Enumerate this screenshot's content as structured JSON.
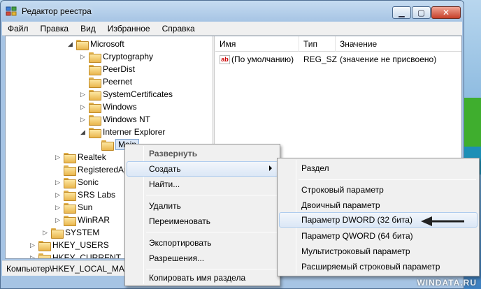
{
  "window": {
    "title": "Редактор реестра"
  },
  "menubar": [
    "Файл",
    "Правка",
    "Вид",
    "Избранное",
    "Справка"
  ],
  "tree": [
    {
      "label": "Microsoft",
      "expander": "◢"
    },
    {
      "label": "Cryptography",
      "expander": "▷"
    },
    {
      "label": "PeerDist",
      "expander": ""
    },
    {
      "label": "Peernet",
      "expander": ""
    },
    {
      "label": "SystemCertificates",
      "expander": "▷"
    },
    {
      "label": "Windows",
      "expander": "▷"
    },
    {
      "label": "Windows NT",
      "expander": "▷"
    },
    {
      "label": "Interner Explorer",
      "expander": "◢"
    },
    {
      "label": "Main",
      "expander": ""
    },
    {
      "label": "Realtek",
      "expander": "▷"
    },
    {
      "label": "RegisteredAp",
      "expander": ""
    },
    {
      "label": "Sonic",
      "expander": "▷"
    },
    {
      "label": "SRS Labs",
      "expander": "▷"
    },
    {
      "label": "Sun",
      "expander": "▷"
    },
    {
      "label": "WinRAR",
      "expander": "▷"
    },
    {
      "label": "SYSTEM",
      "expander": "▷"
    },
    {
      "label": "HKEY_USERS",
      "expander": "▷"
    },
    {
      "label": "HKEY_CURRENT_CO",
      "expander": "▷"
    }
  ],
  "list": {
    "columns": [
      "Имя",
      "Тип",
      "Значение"
    ],
    "rows": [
      {
        "icon": "ab",
        "name": "(По умолчанию)",
        "type": "REG_SZ",
        "value": "(значение не присвоено)"
      }
    ]
  },
  "statusbar": "Компьютер\\HKEY_LOCAL_MAC",
  "context_menu": {
    "items": [
      "Развернуть",
      "Создать",
      "Найти...",
      "Удалить",
      "Переименовать",
      "Экспортировать",
      "Разрешения...",
      "Копировать имя раздела"
    ]
  },
  "submenu": {
    "items": [
      "Раздел",
      "Строковый параметр",
      "Двоичный параметр",
      "Параметр DWORD (32 бита)",
      "Параметр QWORD (64 бита)",
      "Мультистроковый параметр",
      "Расширяемый строковый параметр"
    ]
  },
  "watermark": "WINDATA.RU",
  "colors": {
    "selection": "#dbe7f6",
    "menu_bg": "#f0f0f0",
    "close_button": "#c6402a"
  }
}
